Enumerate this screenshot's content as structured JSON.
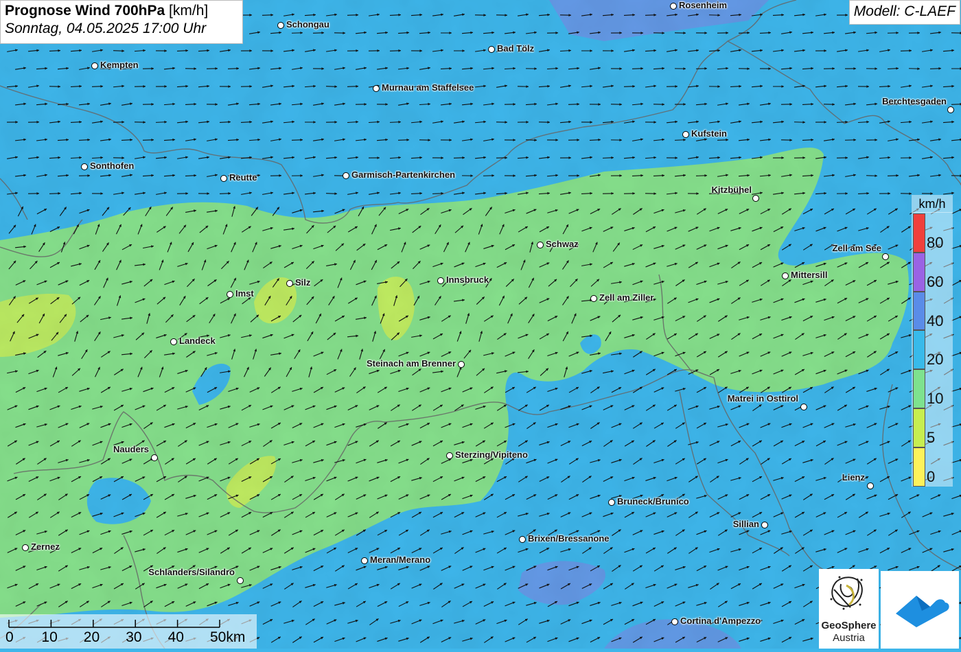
{
  "title": {
    "main": "Prognose Wind 700hPa",
    "unit": "[km/h]",
    "date": "Sonntag, 04.05.2025 17:00 Uhr"
  },
  "model": {
    "label": "Modell: C-LAEF"
  },
  "legend": {
    "unit": "km/h",
    "labels": [
      "80",
      "60",
      "40",
      "20",
      "10",
      "5",
      "0"
    ],
    "colors": [
      "#f0403c",
      "#9a63e4",
      "#5a8ce8",
      "#38baea",
      "#7ee28e",
      "#c7ee50",
      "#fdf25a"
    ]
  },
  "scale": {
    "labels": [
      "0",
      "10",
      "20",
      "30",
      "40",
      "50km"
    ]
  },
  "cities": [
    {
      "name": "Rosenheim"
    },
    {
      "name": "Schongau"
    },
    {
      "name": "Bad Tölz"
    },
    {
      "name": "Kempten"
    },
    {
      "name": "Murnau am Staffelsee"
    },
    {
      "name": "Berchtesgaden"
    },
    {
      "name": "Kufstein"
    },
    {
      "name": "Sonthofen"
    },
    {
      "name": "Reutte"
    },
    {
      "name": "Garmisch-Partenkirchen"
    },
    {
      "name": "Kitzbühel"
    },
    {
      "name": "Schwaz"
    },
    {
      "name": "Zell am See"
    },
    {
      "name": "Mittersill"
    },
    {
      "name": "Silz"
    },
    {
      "name": "Innsbruck"
    },
    {
      "name": "Imst"
    },
    {
      "name": "Zell am Ziller"
    },
    {
      "name": "Landeck"
    },
    {
      "name": "Steinach am Brenner"
    },
    {
      "name": "Matrei in Osttirol"
    },
    {
      "name": "Nauders"
    },
    {
      "name": "Sterzing/Vipiteno"
    },
    {
      "name": "Lienz"
    },
    {
      "name": "Bruneck/Brunico"
    },
    {
      "name": "Sillian"
    },
    {
      "name": "Brixen/Bressanone"
    },
    {
      "name": "Zernez"
    },
    {
      "name": "Meran/Merano"
    },
    {
      "name": "Schlanders/Silandro"
    },
    {
      "name": "Cortina d'Ampezzo"
    }
  ],
  "logos": {
    "geosphere_line1": "GeoSphere",
    "geosphere_line2": "Austria"
  }
}
